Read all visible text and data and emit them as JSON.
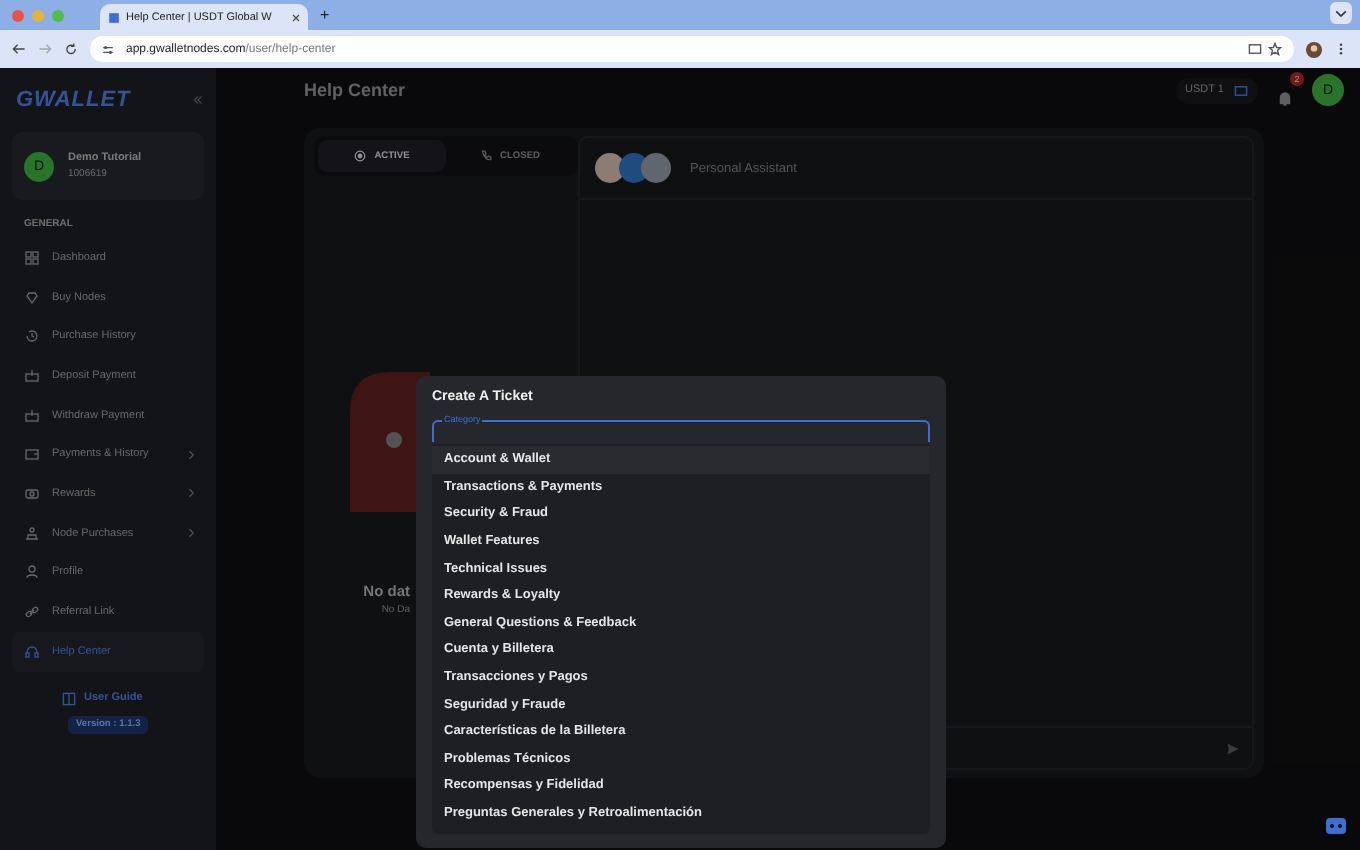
{
  "browser": {
    "tab_title": "Help Center | USDT Global W",
    "new_tab": "+",
    "url_host": "app.gwalletnodes.com",
    "url_path": "/user/help-center"
  },
  "sidebar": {
    "logo": "GWALLET",
    "user": {
      "initial": "D",
      "name": "Demo Tutorial",
      "id": "1006619"
    },
    "section": "GENERAL",
    "items": [
      {
        "label": "Dashboard",
        "expandable": false,
        "selected": false
      },
      {
        "label": "Buy Nodes",
        "expandable": false,
        "selected": false
      },
      {
        "label": "Purchase History",
        "expandable": false,
        "selected": false
      },
      {
        "label": "Deposit Payment",
        "expandable": false,
        "selected": false
      },
      {
        "label": "Withdraw Payment",
        "expandable": false,
        "selected": false
      },
      {
        "label": "Payments & History",
        "expandable": true,
        "selected": false
      },
      {
        "label": "Rewards",
        "expandable": true,
        "selected": false
      },
      {
        "label": "Node Purchases",
        "expandable": true,
        "selected": false
      },
      {
        "label": "Profile",
        "expandable": false,
        "selected": false
      },
      {
        "label": "Referral Link",
        "expandable": false,
        "selected": false
      },
      {
        "label": "Help Center",
        "expandable": false,
        "selected": true
      }
    ],
    "user_guide": "User Guide",
    "version": "Version : 1.1.3"
  },
  "header": {
    "title": "Help Center",
    "balance": "USDT 1",
    "notifications": "2",
    "avatar": "D"
  },
  "tickets": {
    "tabs": [
      {
        "label": "ACTIVE",
        "selected": true
      },
      {
        "label": "CLOSED",
        "selected": false
      }
    ],
    "empty_title": "No dat",
    "empty_subtitle": "No Da"
  },
  "chat": {
    "title": "Personal Assistant"
  },
  "dialog": {
    "title": "Create A Ticket",
    "field_label": "Category",
    "options": [
      {
        "label": "Account & Wallet",
        "selected": true
      },
      {
        "label": "Transactions & Payments",
        "selected": false
      },
      {
        "label": "Security & Fraud",
        "selected": false
      },
      {
        "label": "Wallet Features",
        "selected": false
      },
      {
        "label": "Technical Issues",
        "selected": false
      },
      {
        "label": "Rewards & Loyalty",
        "selected": false
      },
      {
        "label": "General Questions & Feedback",
        "selected": false
      },
      {
        "label": "Cuenta y Billetera",
        "selected": false
      },
      {
        "label": "Transacciones y Pagos",
        "selected": false
      },
      {
        "label": "Seguridad y Fraude",
        "selected": false
      },
      {
        "label": "Características de la Billetera",
        "selected": false
      },
      {
        "label": "Problemas Técnicos",
        "selected": false
      },
      {
        "label": "Recompensas y Fidelidad",
        "selected": false
      },
      {
        "label": "Preguntas Generales y Retroalimentación",
        "selected": false
      }
    ]
  }
}
